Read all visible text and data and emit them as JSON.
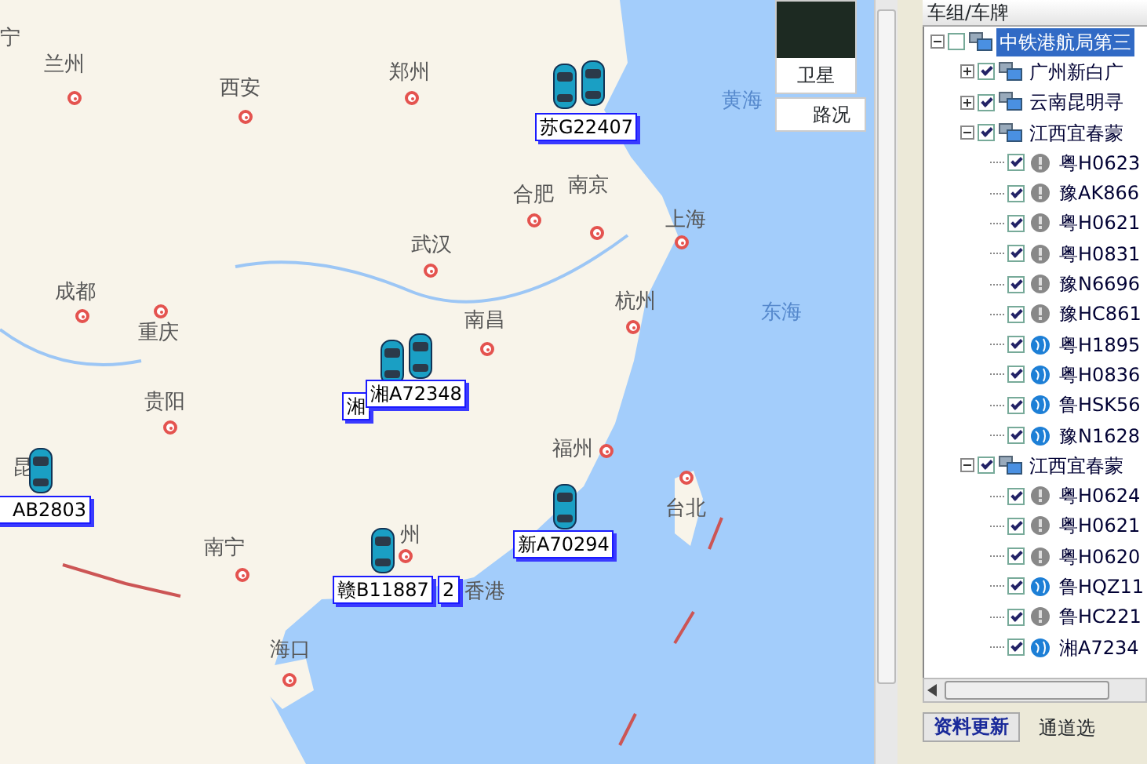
{
  "map": {
    "places": [
      {
        "name": "宁",
        "kind": "city",
        "dot": false
      },
      {
        "name": "兰州",
        "kind": "city",
        "dot": true
      },
      {
        "name": "西安",
        "kind": "city",
        "dot": true
      },
      {
        "name": "郑州",
        "kind": "city",
        "dot": true
      },
      {
        "name": "合肥",
        "kind": "city",
        "dot": true
      },
      {
        "name": "南京",
        "kind": "city",
        "dot": true
      },
      {
        "name": "上海",
        "kind": "city",
        "dot": true
      },
      {
        "name": "武汉",
        "kind": "city",
        "dot": true
      },
      {
        "name": "杭州",
        "kind": "city",
        "dot": true
      },
      {
        "name": "成都",
        "kind": "city",
        "dot": true
      },
      {
        "name": "重庆",
        "kind": "city",
        "dot": true
      },
      {
        "name": "南昌",
        "kind": "city",
        "dot": true
      },
      {
        "name": "贵阳",
        "kind": "city",
        "dot": true
      },
      {
        "name": "福州",
        "kind": "city",
        "dot": true
      },
      {
        "name": "台北",
        "kind": "city",
        "dot": true
      },
      {
        "name": "南宁",
        "kind": "city",
        "dot": true
      },
      {
        "name": "海口",
        "kind": "city",
        "dot": true
      },
      {
        "name": "州",
        "kind": "city",
        "dot": true
      },
      {
        "name": "香港",
        "kind": "city",
        "dot": false
      },
      {
        "name": "昆",
        "kind": "city",
        "dot": false
      },
      {
        "name": "黄海",
        "kind": "sea",
        "dot": false
      },
      {
        "name": "东海",
        "kind": "sea",
        "dot": false
      }
    ],
    "vehicles": [
      {
        "plate": "苏G22407"
      },
      {
        "plate": "湘"
      },
      {
        "plate": "湘A72348"
      },
      {
        "plate": "AB2803"
      },
      {
        "plate": "新A70294"
      },
      {
        "plate": "赣B11887"
      },
      {
        "plate": "2"
      }
    ],
    "layers": [
      {
        "label": "卫星",
        "thumbnail": true
      },
      {
        "label": "路况",
        "thumbnail": false
      }
    ]
  },
  "panel": {
    "header": "车组/车牌",
    "tree": [
      {
        "label": "中铁港航局第三",
        "checked": false,
        "expanded": true,
        "selected": true,
        "children": [
          {
            "label": "广州新白广",
            "checked": true,
            "expanded": false,
            "selected": false
          },
          {
            "label": "云南昆明寻",
            "checked": true,
            "expanded": false,
            "selected": false
          },
          {
            "label": "江西宜春蒙",
            "checked": true,
            "expanded": true,
            "selected": false,
            "children": [
              {
                "label": "粤H0623",
                "checked": true,
                "online": false,
                "selected": false
              },
              {
                "label": "豫AK866",
                "checked": true,
                "online": false,
                "selected": false
              },
              {
                "label": "粤H0621",
                "checked": true,
                "online": false,
                "selected": false
              },
              {
                "label": "粤H0831",
                "checked": true,
                "online": false,
                "selected": false
              },
              {
                "label": "豫N6696",
                "checked": true,
                "online": false,
                "selected": false
              },
              {
                "label": "豫HC861",
                "checked": true,
                "online": false,
                "selected": false
              },
              {
                "label": "粤H1895",
                "checked": true,
                "online": true,
                "selected": false
              },
              {
                "label": "粤H0836",
                "checked": true,
                "online": true,
                "selected": false
              },
              {
                "label": "鲁HSK56",
                "checked": true,
                "online": true,
                "selected": false
              },
              {
                "label": "豫N1628",
                "checked": true,
                "online": true,
                "selected": false
              }
            ]
          },
          {
            "label": "江西宜春蒙",
            "checked": true,
            "expanded": true,
            "selected": false,
            "children": [
              {
                "label": "粤H0624",
                "checked": true,
                "online": false,
                "selected": false
              },
              {
                "label": "粤H0621",
                "checked": true,
                "online": false,
                "selected": false
              },
              {
                "label": "粤H0620",
                "checked": true,
                "online": false,
                "selected": false
              },
              {
                "label": "鲁HQZ11",
                "checked": true,
                "online": true,
                "selected": false
              },
              {
                "label": "鲁HC221",
                "checked": true,
                "online": false,
                "selected": false
              },
              {
                "label": "湘A7234",
                "checked": true,
                "online": true,
                "selected": false
              }
            ]
          }
        ]
      }
    ],
    "refresh_button": "资料更新",
    "channel_label": "通道选"
  }
}
